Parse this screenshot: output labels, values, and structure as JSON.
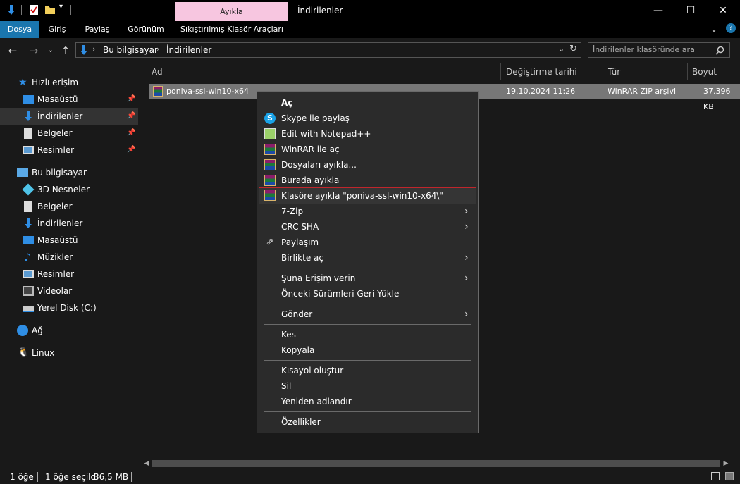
{
  "titlebar": {
    "context_tab": "Ayıkla",
    "window_title": "İndirilenler"
  },
  "ribbon": {
    "tabs": [
      "Dosya",
      "Giriş",
      "Paylaş",
      "Görünüm",
      "Sıkıştırılmış Klasör Araçları"
    ]
  },
  "address": {
    "crumbs": [
      "Bu bilgisayar",
      "İndirilenler"
    ],
    "search_placeholder": "İndirilenler klasöründe ara"
  },
  "nav": {
    "quick_access": "Hızlı erişim",
    "quick_items": [
      "Masaüstü",
      "İndirilenler",
      "Belgeler",
      "Resimler"
    ],
    "this_pc": "Bu bilgisayar",
    "pc_items": [
      "3D Nesneler",
      "Belgeler",
      "İndirilenler",
      "Masaüstü",
      "Müzikler",
      "Resimler",
      "Videolar",
      "Yerel Disk (C:)"
    ],
    "network": "Ağ",
    "linux": "Linux"
  },
  "columns": [
    "Ad",
    "Değiştirme tarihi",
    "Tür",
    "Boyut"
  ],
  "file": {
    "name": "poniva-ssl-win10-x64",
    "date": "19.10.2024 11:26",
    "type": "WinRAR ZIP arşivi",
    "size": "37.396 KB"
  },
  "status": {
    "count": "1 öğe",
    "selected": "1 öğe seçildi",
    "size": "36,5 MB"
  },
  "context_menu": {
    "items": [
      {
        "label": "Aç",
        "icon": "none"
      },
      {
        "label": "Skype ile paylaş",
        "icon": "skype-icon"
      },
      {
        "label": "Edit with Notepad++",
        "icon": "notepad-icon"
      },
      {
        "label": "WinRAR ile aç",
        "icon": "winrar-icon"
      },
      {
        "label": "Dosyaları ayıkla...",
        "icon": "winrar-icon"
      },
      {
        "label": "Burada ayıkla",
        "icon": "winrar-icon"
      },
      {
        "label": "Klasöre ayıkla \"poniva-ssl-win10-x64\\\"",
        "icon": "winrar-icon"
      },
      {
        "label": "7-Zip",
        "icon": "none"
      },
      {
        "label": "CRC SHA",
        "icon": "none"
      },
      {
        "label": "Paylaşım",
        "icon": "share-icon"
      },
      {
        "label": "Birlikte aç",
        "icon": "none"
      },
      {
        "label": "Şuna Erişim verin",
        "icon": "none"
      },
      {
        "label": "Önceki Sürümleri Geri Yükle",
        "icon": "none"
      },
      {
        "label": "Gönder",
        "icon": "none"
      },
      {
        "label": "Kes",
        "icon": "none"
      },
      {
        "label": "Kopyala",
        "icon": "none"
      },
      {
        "label": "Kısayol oluştur",
        "icon": "none"
      },
      {
        "label": "Sil",
        "icon": "none"
      },
      {
        "label": "Yeniden adlandır",
        "icon": "none"
      },
      {
        "label": "Özellikler",
        "icon": "none"
      }
    ]
  },
  "colors": {
    "accent": "#1a76ae",
    "context_tab": "#f7c6e0",
    "highlight_border": "#c0262c"
  }
}
